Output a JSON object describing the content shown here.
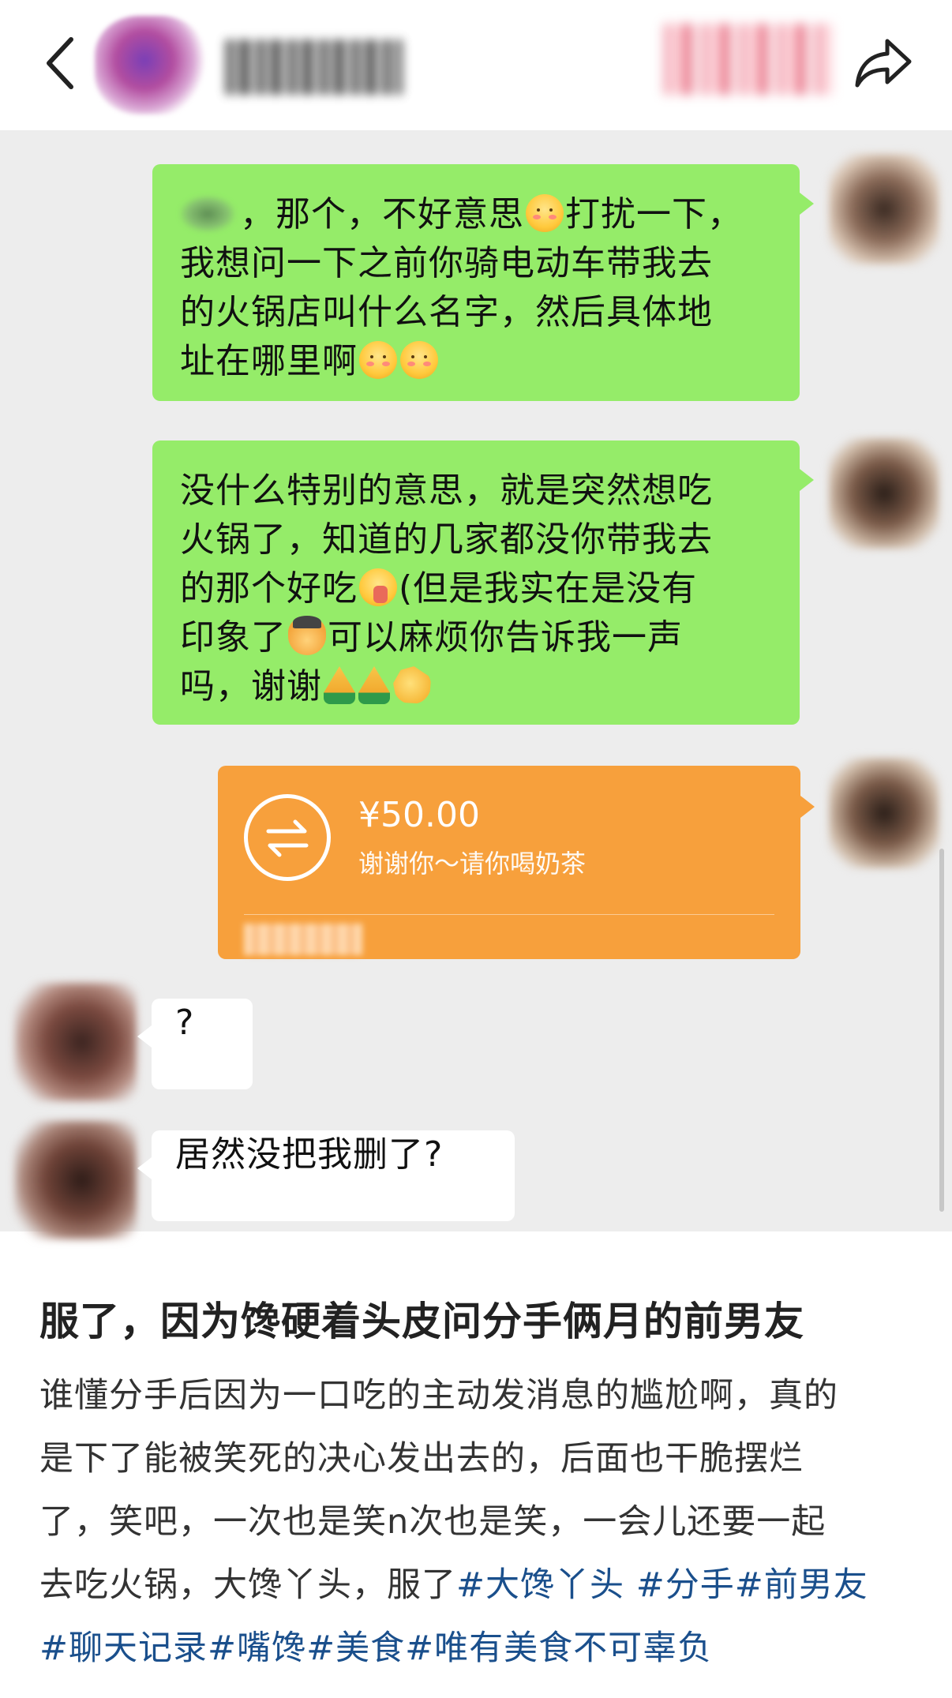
{
  "chat": {
    "messages": [
      {
        "side": "right",
        "type": "text",
        "line1": "，那个，不好意思",
        "line1b": "打扰一下，",
        "line2": "我想问一下之前你骑电动车带我去",
        "line3": "的火锅店叫什么名字，然后具体地",
        "line4": "址在哪里啊"
      },
      {
        "side": "right",
        "type": "text",
        "line1": "没什么特别的意思，就是突然想吃",
        "line2": "火锅了，知道的几家都没你带我去",
        "line3a": "的那个好吃",
        "line3b": "(但是我实在是没有",
        "line4a": "印象了",
        "line4b": "可以麻烦你告诉我一声",
        "line5": "吗，谢谢"
      },
      {
        "side": "right",
        "type": "transfer",
        "amount": "¥50.00",
        "note": "谢谢你～请你喝奶茶"
      },
      {
        "side": "left",
        "type": "text",
        "text": "?"
      },
      {
        "side": "left",
        "type": "text",
        "text": "居然没把我删了?"
      }
    ]
  },
  "post": {
    "title": "服了，因为馋硬着头皮问分手俩月的前男友",
    "body_line1": "谁懂分手后因为一口吃的主动发消息的尴尬啊，真的",
    "body_line2": "是下了能被笑死的决心发出去的，后面也干脆摆烂",
    "body_line3": "了，笑吧，一次也是笑n次也是笑，一会儿还要一起",
    "body_line4": "去吃火锅，大馋丫头，服了",
    "tags_line4": [
      "#大馋丫头",
      " #分手",
      "#前男友"
    ],
    "tags_line5": [
      "#聊天记录",
      "#嘴馋",
      "#美食",
      "#唯有美食不可辜负"
    ]
  },
  "icons": {
    "back": "chevron-left-icon",
    "share": "share-arrow-icon",
    "transfer": "transfer-arrows-icon"
  },
  "colors": {
    "chat_bg": "#ededed",
    "bubble_green": "#95ec69",
    "transfer_orange": "#f7a03c",
    "tag_blue": "#1a4f8c"
  }
}
